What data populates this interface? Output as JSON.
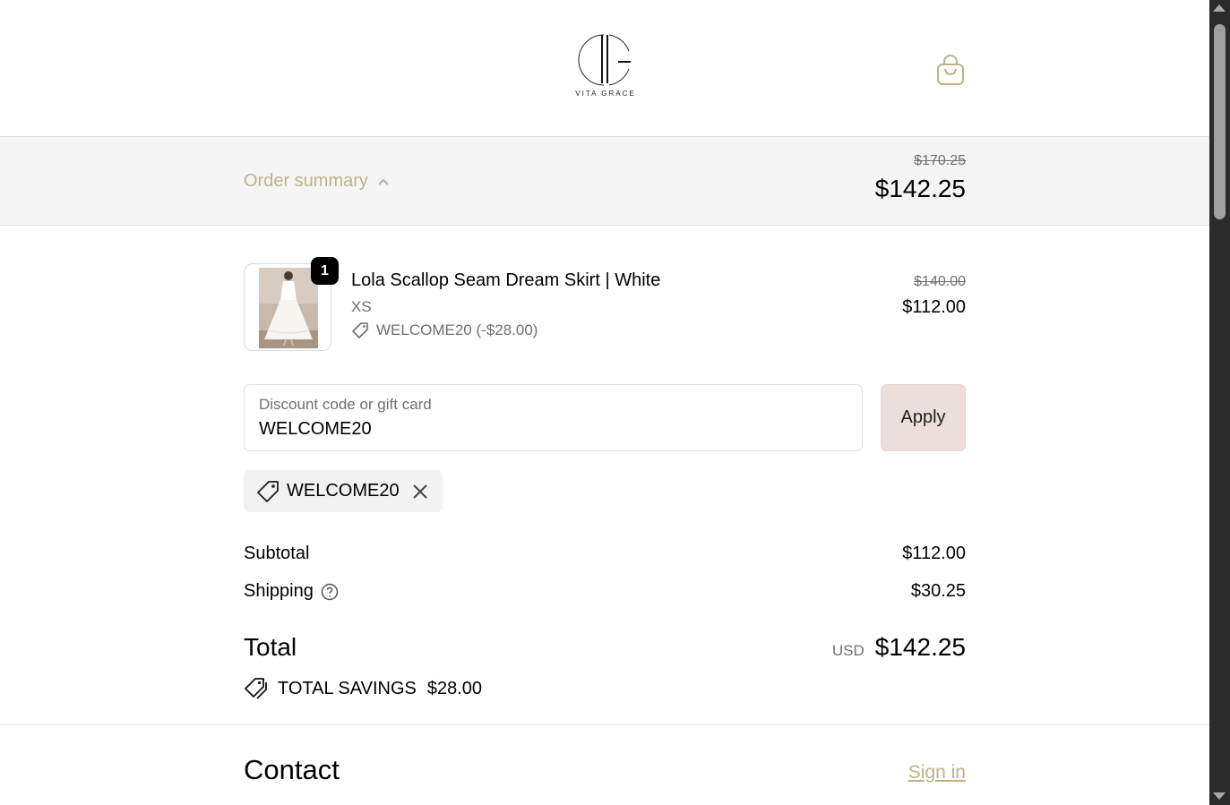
{
  "brand": {
    "name": "VITA GRACE",
    "accent_color": "#bdb38a"
  },
  "summary": {
    "toggle_label": "Order summary",
    "compare_at_total": "$170.25",
    "total": "$142.25"
  },
  "line_item": {
    "quantity": "1",
    "title": "Lola Scallop Seam Dream Skirt | White",
    "variant": "XS",
    "discount": "WELCOME20 (-$28.00)",
    "compare_at_price": "$140.00",
    "price": "$112.00"
  },
  "discount_field": {
    "label": "Discount code or gift card",
    "value": "WELCOME20",
    "apply_label": "Apply"
  },
  "applied_code": {
    "code": "WELCOME20"
  },
  "totals": {
    "subtotal_label": "Subtotal",
    "subtotal_value": "$112.00",
    "shipping_label": "Shipping",
    "shipping_value": "$30.25",
    "total_label": "Total",
    "currency": "USD",
    "total_value": "$142.25",
    "savings_label": "TOTAL SAVINGS",
    "savings_value": "$28.00"
  },
  "contact": {
    "heading": "Contact",
    "sign_in_label": "Sign in"
  }
}
